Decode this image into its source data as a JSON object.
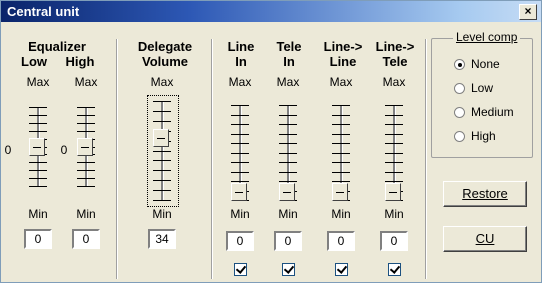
{
  "window": {
    "title": "Central unit",
    "close": "×"
  },
  "columns": [
    {
      "id": "eq-low",
      "header": [
        "Equalizer",
        "Low"
      ],
      "value": "0",
      "zero_label": "0",
      "level": 0.5,
      "check": false
    },
    {
      "id": "eq-high",
      "header": [
        "",
        "High"
      ],
      "value": "0",
      "zero_label": "0",
      "level": 0.5,
      "check": false
    },
    {
      "id": "delegate",
      "header": [
        "Delegate",
        "Volume"
      ],
      "value": "34",
      "level": 0.66,
      "check": false
    },
    {
      "id": "line-in",
      "header": [
        "Line",
        "In"
      ],
      "value": "0",
      "level": 0.0,
      "check": true
    },
    {
      "id": "tele-in",
      "header": [
        "Tele",
        "In"
      ],
      "value": "0",
      "level": 0.0,
      "check": true
    },
    {
      "id": "line-line",
      "header": [
        "Line->",
        "Line"
      ],
      "value": "0",
      "level": 0.0,
      "check": true
    },
    {
      "id": "line-tele",
      "header": [
        "Line->",
        "Tele"
      ],
      "value": "0",
      "level": 0.0,
      "check": true
    }
  ],
  "max_label": "Max",
  "min_label": "Min",
  "level_comp": {
    "legend": "Level comp",
    "options": [
      "None",
      "Low",
      "Medium",
      "High"
    ],
    "selected": "None"
  },
  "buttons": {
    "restore": "Restore",
    "cu": "CU"
  }
}
